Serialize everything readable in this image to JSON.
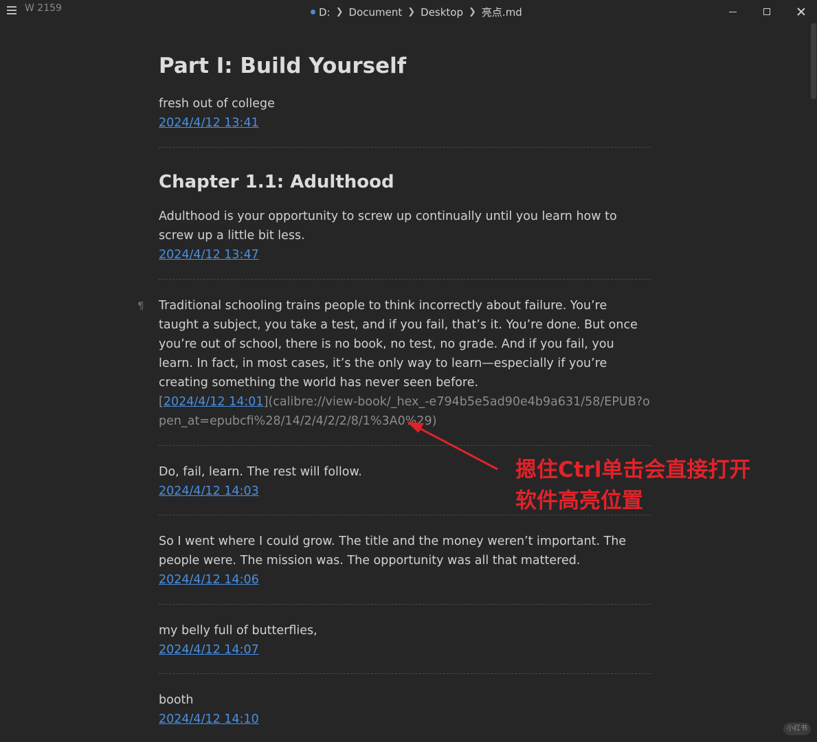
{
  "titlebar": {
    "word_count": "W 2159",
    "breadcrumb": [
      "D:",
      "Document",
      "Desktop",
      "亮点.md"
    ],
    "minimize_label": "",
    "maximize_label": "",
    "close_label": ""
  },
  "document": {
    "h1": "Part I: Build Yourself",
    "blocks": [
      {
        "type": "para",
        "text": "fresh out of college"
      },
      {
        "type": "link",
        "text": "2024/4/12 13:41"
      },
      {
        "type": "h2",
        "text": "Chapter 1.1: Adulthood"
      },
      {
        "type": "para",
        "text": "Adulthood is your opportunity to screw up continually until you learn how to screw up a little bit less."
      },
      {
        "type": "link",
        "text": "2024/4/12 13:47"
      },
      {
        "type": "para",
        "text": "Traditional schooling trains people to think incorrectly about failure. You’re taught a subject, you take a test, and if you fail, that’s it. You’re done. But once you’re out of school, there is no book, no test, no grade. And if you fail, you learn. In fact, in most cases, it’s the only way to learn—especially if you’re creating something the world has never seen before."
      },
      {
        "type": "source",
        "link_text": "2024/4/12 14:01",
        "url_text": "(calibre://view-book/_hex_-e794b5e5ad90e4b9a631/58/EPUB?open_at=epubcfi%28/14/2/4/2/2/8/1%3A0%29)"
      },
      {
        "type": "para",
        "text": "Do, fail, learn. The rest will follow."
      },
      {
        "type": "link",
        "text": "2024/4/12 14:03"
      },
      {
        "type": "para",
        "text": "So I went where I could grow. The title and the money weren’t important. The people were. The mission was. The opportunity was all that mattered."
      },
      {
        "type": "link",
        "text": "2024/4/12 14:06"
      },
      {
        "type": "para",
        "text": "my belly full of butterflies,"
      },
      {
        "type": "link",
        "text": "2024/4/12 14:07"
      },
      {
        "type": "para",
        "text": "booth"
      },
      {
        "type": "link",
        "text": "2024/4/12 14:10"
      }
    ],
    "pilcrow": "¶",
    "bracket_open": "[",
    "bracket_close": "]"
  },
  "annotation": {
    "line1": "摁住Ctrl单击会直接打开",
    "line2": "软件高亮位置",
    "color": "#e2222a"
  },
  "watermark": "小红书",
  "colors": {
    "link": "#4a8fe0",
    "background": "#262626",
    "text": "#d2d2d2"
  }
}
